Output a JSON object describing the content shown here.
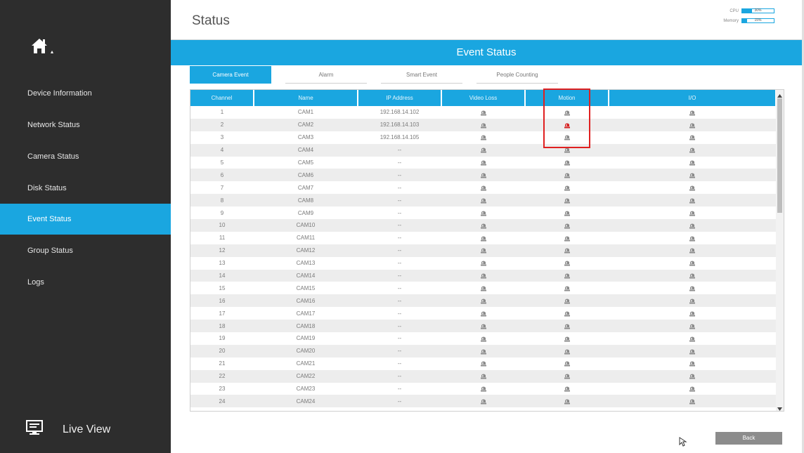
{
  "sidebar": {
    "home_icon": "home-icon",
    "items": [
      {
        "label": "Device Information"
      },
      {
        "label": "Network Status"
      },
      {
        "label": "Camera Status"
      },
      {
        "label": "Disk Status"
      },
      {
        "label": "Event Status",
        "active": true
      },
      {
        "label": "Group Status"
      },
      {
        "label": "Logs"
      }
    ],
    "live_view": {
      "label": "Live View",
      "icon": "monitor-icon"
    }
  },
  "header": {
    "title": "Status",
    "cpu": {
      "label": "CPU",
      "value": "30%",
      "fraction": 0.3
    },
    "memory": {
      "label": "Memory",
      "value": "15%",
      "fraction": 0.15
    }
  },
  "banner": {
    "title": "Event Status"
  },
  "tabs": [
    {
      "label": "Camera Event",
      "active": true
    },
    {
      "label": "Alarm"
    },
    {
      "label": "Smart Event"
    },
    {
      "label": "People Counting"
    }
  ],
  "table": {
    "columns": [
      "Channel",
      "Name",
      "IP Address",
      "Video Loss",
      "Motion",
      "I/O"
    ],
    "rows": [
      {
        "channel": "1",
        "name": "CAM1",
        "ip": "192.168.14.102",
        "motion_alarm": false
      },
      {
        "channel": "2",
        "name": "CAM2",
        "ip": "192.168.14.103",
        "motion_alarm": true
      },
      {
        "channel": "3",
        "name": "CAM3",
        "ip": "192.168.14.105",
        "motion_alarm": false
      },
      {
        "channel": "4",
        "name": "CAM4",
        "ip": "--",
        "motion_alarm": false
      },
      {
        "channel": "5",
        "name": "CAM5",
        "ip": "--",
        "motion_alarm": false
      },
      {
        "channel": "6",
        "name": "CAM6",
        "ip": "--",
        "motion_alarm": false
      },
      {
        "channel": "7",
        "name": "CAM7",
        "ip": "--",
        "motion_alarm": false
      },
      {
        "channel": "8",
        "name": "CAM8",
        "ip": "--",
        "motion_alarm": false
      },
      {
        "channel": "9",
        "name": "CAM9",
        "ip": "--",
        "motion_alarm": false
      },
      {
        "channel": "10",
        "name": "CAM10",
        "ip": "--",
        "motion_alarm": false
      },
      {
        "channel": "11",
        "name": "CAM11",
        "ip": "--",
        "motion_alarm": false
      },
      {
        "channel": "12",
        "name": "CAM12",
        "ip": "--",
        "motion_alarm": false
      },
      {
        "channel": "13",
        "name": "CAM13",
        "ip": "--",
        "motion_alarm": false
      },
      {
        "channel": "14",
        "name": "CAM14",
        "ip": "--",
        "motion_alarm": false
      },
      {
        "channel": "15",
        "name": "CAM15",
        "ip": "--",
        "motion_alarm": false
      },
      {
        "channel": "16",
        "name": "CAM16",
        "ip": "--",
        "motion_alarm": false
      },
      {
        "channel": "17",
        "name": "CAM17",
        "ip": "--",
        "motion_alarm": false
      },
      {
        "channel": "18",
        "name": "CAM18",
        "ip": "--",
        "motion_alarm": false
      },
      {
        "channel": "19",
        "name": "CAM19",
        "ip": "--",
        "motion_alarm": false
      },
      {
        "channel": "20",
        "name": "CAM20",
        "ip": "--",
        "motion_alarm": false
      },
      {
        "channel": "21",
        "name": "CAM21",
        "ip": "--",
        "motion_alarm": false
      },
      {
        "channel": "22",
        "name": "CAM22",
        "ip": "--",
        "motion_alarm": false
      },
      {
        "channel": "23",
        "name": "CAM23",
        "ip": "--",
        "motion_alarm": false
      },
      {
        "channel": "24",
        "name": "CAM24",
        "ip": "--",
        "motion_alarm": false
      }
    ]
  },
  "colors": {
    "accent": "#1aa6e0",
    "alarm": "#d42020",
    "sidebar_bg": "#2d2d2d",
    "highlight_box": "#e02020"
  },
  "back_button": {
    "label": "Back"
  }
}
